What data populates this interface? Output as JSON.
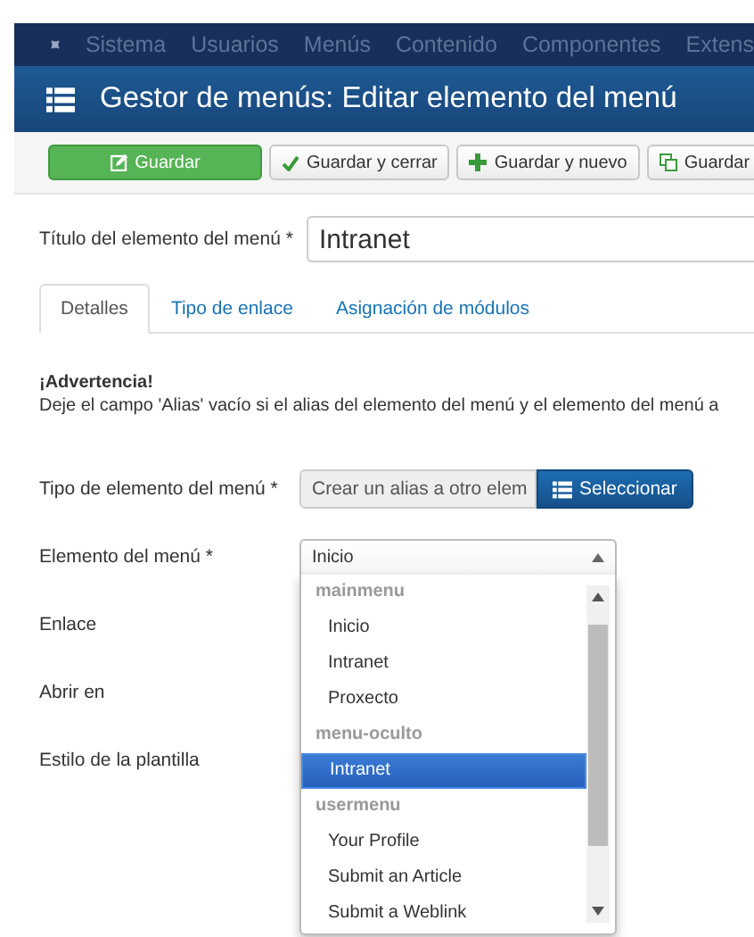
{
  "nav": {
    "items": [
      "Sistema",
      "Usuarios",
      "Menús",
      "Contenido",
      "Componentes",
      "Extens"
    ]
  },
  "header": {
    "title": "Gestor de menús: Editar elemento del menú"
  },
  "toolbar": {
    "buttons": [
      {
        "label": "Guardar",
        "kind": "primary"
      },
      {
        "label": "Guardar y cerrar",
        "kind": "default"
      },
      {
        "label": "Guardar y nuevo",
        "kind": "default"
      },
      {
        "label": "Guardar",
        "kind": "default"
      }
    ]
  },
  "title_field": {
    "label": "Título del elemento del menú *",
    "value": "Intranet"
  },
  "tabs": [
    {
      "label": "Detalles",
      "selected": true
    },
    {
      "label": "Tipo de enlace",
      "selected": false
    },
    {
      "label": "Asignación de módulos",
      "selected": false
    }
  ],
  "warning": {
    "heading": "¡Advertencia!",
    "text": "Deje el campo 'Alias' vacío si el alias del elemento del menú y el elemento del menú a"
  },
  "fields": [
    {
      "label": "Tipo de elemento del menú *",
      "kind": "type",
      "value": "Crear un alias a otro elem",
      "button": "Seleccionar"
    },
    {
      "label": "Elemento del menú *",
      "kind": "select",
      "value": "Inicio"
    },
    {
      "label": "Enlace",
      "kind": "plain"
    },
    {
      "label": "Abrir en",
      "kind": "plain"
    },
    {
      "label": "Estilo de la plantilla",
      "kind": "plain"
    }
  ],
  "dropdown": {
    "groups": [
      {
        "label": "mainmenu",
        "options": [
          {
            "label": "Inicio",
            "selected": false
          },
          {
            "label": "Intranet",
            "selected": false
          },
          {
            "label": "Proxecto",
            "selected": false
          }
        ]
      },
      {
        "label": "menu-oculto",
        "options": [
          {
            "label": "Intranet",
            "selected": true
          }
        ]
      },
      {
        "label": "usermenu",
        "options": [
          {
            "label": "Your Profile",
            "selected": false
          },
          {
            "label": "Submit an Article",
            "selected": false
          },
          {
            "label": "Submit a Weblink",
            "selected": false
          }
        ]
      }
    ]
  }
}
